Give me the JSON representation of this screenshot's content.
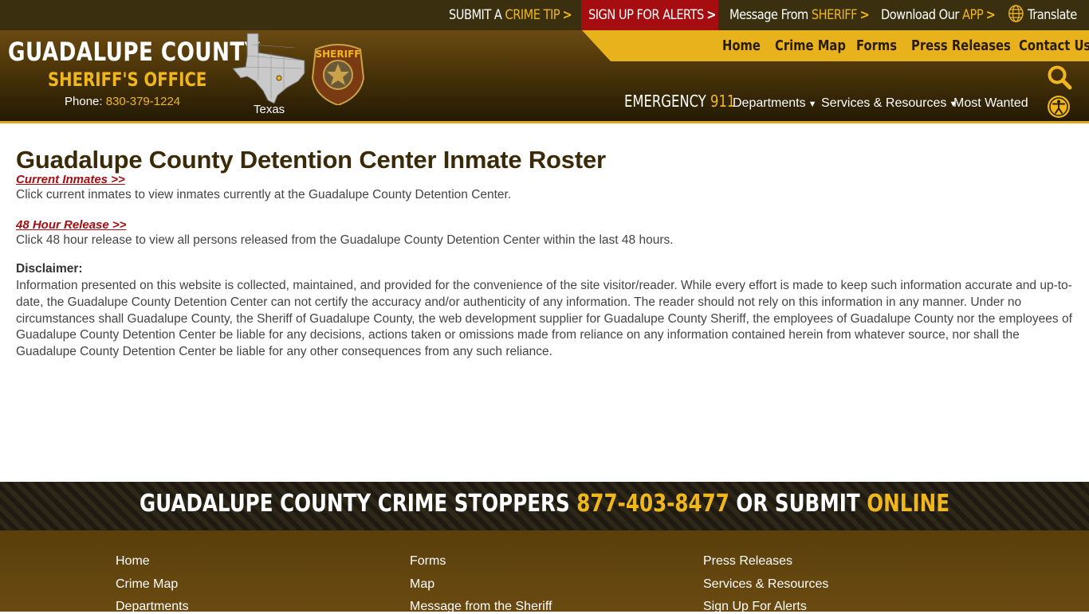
{
  "topbar": {
    "crime_tip_prefix": "SUBMIT A ",
    "crime_tip_highlight": "CRIME TIP",
    "alerts_label": "SIGN UP FOR ALERTS",
    "message_prefix": "Message From ",
    "message_highlight": "SHERIFF",
    "app_prefix": "Download Our ",
    "app_highlight": "APP",
    "translate_label": "Translate",
    "chevron": ">"
  },
  "brand": {
    "county": "GUADALUPE COUNTY",
    "office": "SHERIFF'S OFFICE",
    "phone_label": "Phone: ",
    "phone_number": "830-379-1224",
    "map_label": "Texas",
    "badge_text": "SHERIFF"
  },
  "main_nav": [
    "Home",
    "Crime Map",
    "Forms",
    "Press Releases",
    "Contact Us"
  ],
  "sub_nav": {
    "emergency_label": "EMERGENCY ",
    "emergency_number": "911",
    "departments": "Departments",
    "services": "Services & Resources",
    "most_wanted": "Most Wanted"
  },
  "content": {
    "title": "Guadalupe County Detention Center Inmate Roster",
    "current_link": "Current Inmates >>",
    "current_text": "Click current inmates to view inmates currently at the Guadalupe County Detention Center.",
    "release_link": "48 Hour Release >>",
    "release_text": "Click 48 hour release to view all persons released from the Guadalupe County Detention Center within the last 48 hours.",
    "disclaimer_heading": "Disclaimer:",
    "disclaimer_body": "Information presented on this website is collected, maintained, and provided for the convenience of the site visitor/reader. While every effort is made to keep such information accurate and up-to-date, the Guadalupe County Detention Center can not certify the accuracy and/or authenticity of any information. The reader should not rely on this information in any manner. Under no circumstances shall Guadalupe County, the Sheriff of Guadalupe County, the web development supplier for Guadalupe County Sheriff, the employees of Guadalupe County nor the employees of Guadalupe County Detention Center be liable for any decisions, actions taken or omissions made from reliance on any information contained herein from whatever source, nor shall the Guadalupe County Detention Center be liable for any other consequences from any such reliance."
  },
  "stoppers": {
    "prefix": "GUADALUPE COUNTY CRIME STOPPERS ",
    "phone": "877-403-8477",
    "middle": " OR SUBMIT ",
    "online": "ONLINE"
  },
  "footer": {
    "col1": [
      "Home",
      "Crime Map",
      "Departments"
    ],
    "col2": [
      "Forms",
      "Map",
      "Message from the Sheriff"
    ],
    "col3": [
      "Press Releases",
      "Services & Resources",
      "Sign Up For Alerts"
    ]
  },
  "colors": {
    "gold": "#f0b71d",
    "brown": "#4a3408",
    "alert_red": "#a50d10",
    "link_red": "#a50d10"
  },
  "icons": [
    "chevron-right-icon",
    "globe-icon",
    "texas-map-icon",
    "sheriff-badge-icon",
    "chevron-down-icon",
    "search-icon",
    "accessibility-icon"
  ]
}
